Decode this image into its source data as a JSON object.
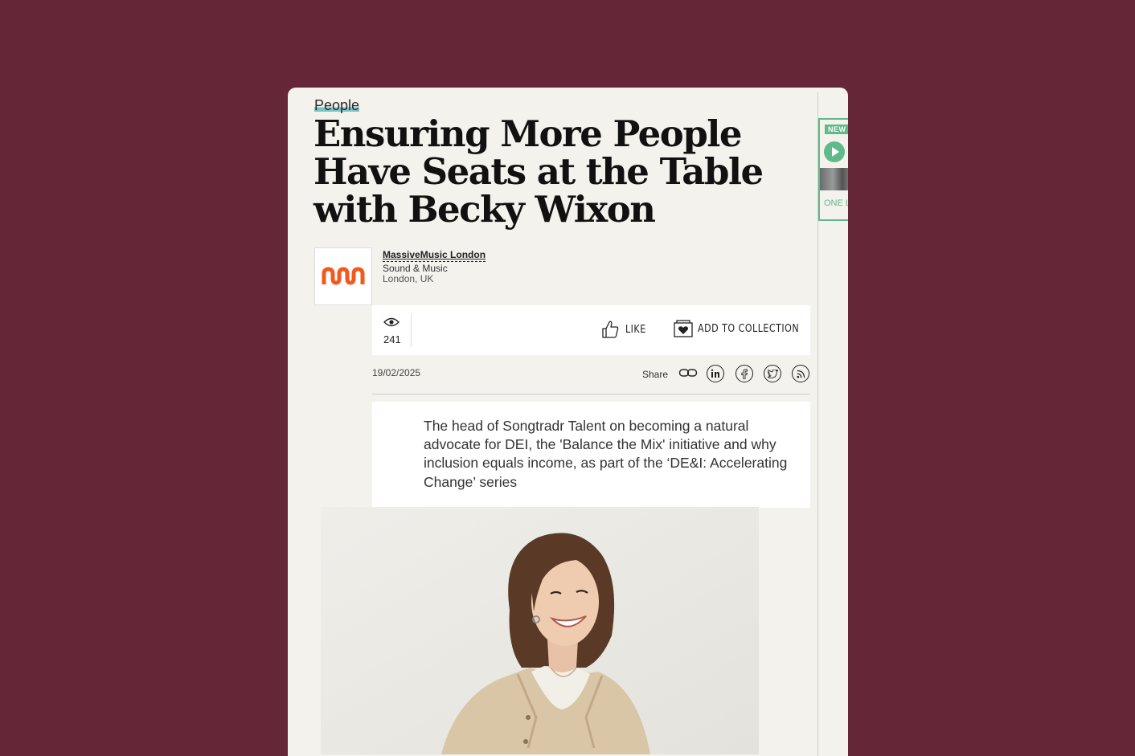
{
  "article": {
    "category": "People",
    "title": "Ensuring More People Have Seats at the Table with Becky Wixon",
    "summary": "The head of Songtradr Talent on becoming a natural advocate for DEI, the 'Balance the Mix' initiative and why inclusion equals income, as part of the ‘DE&I: Accelerating Change’ series",
    "date": "19/02/2025"
  },
  "company": {
    "name": "MassiveMusic London",
    "category": "Sound & Music",
    "location": "London, UK",
    "logo_color": "#f05a1e"
  },
  "stats": {
    "views": "241"
  },
  "actions": {
    "like_label": "LIKE",
    "collection_label": "ADD TO COLLECTION"
  },
  "share": {
    "label": "Share",
    "icons": [
      "link-icon",
      "linkedin-icon",
      "facebook-icon",
      "twitter-icon",
      "rss-icon"
    ]
  },
  "sidebar_promo": {
    "badge": "NEW",
    "text": "ONE L",
    "accent": "#5fb98a"
  },
  "colors": {
    "page_bg": "#652637",
    "card_bg": "#f3f2ed",
    "category_highlight": "#79c3c6"
  }
}
